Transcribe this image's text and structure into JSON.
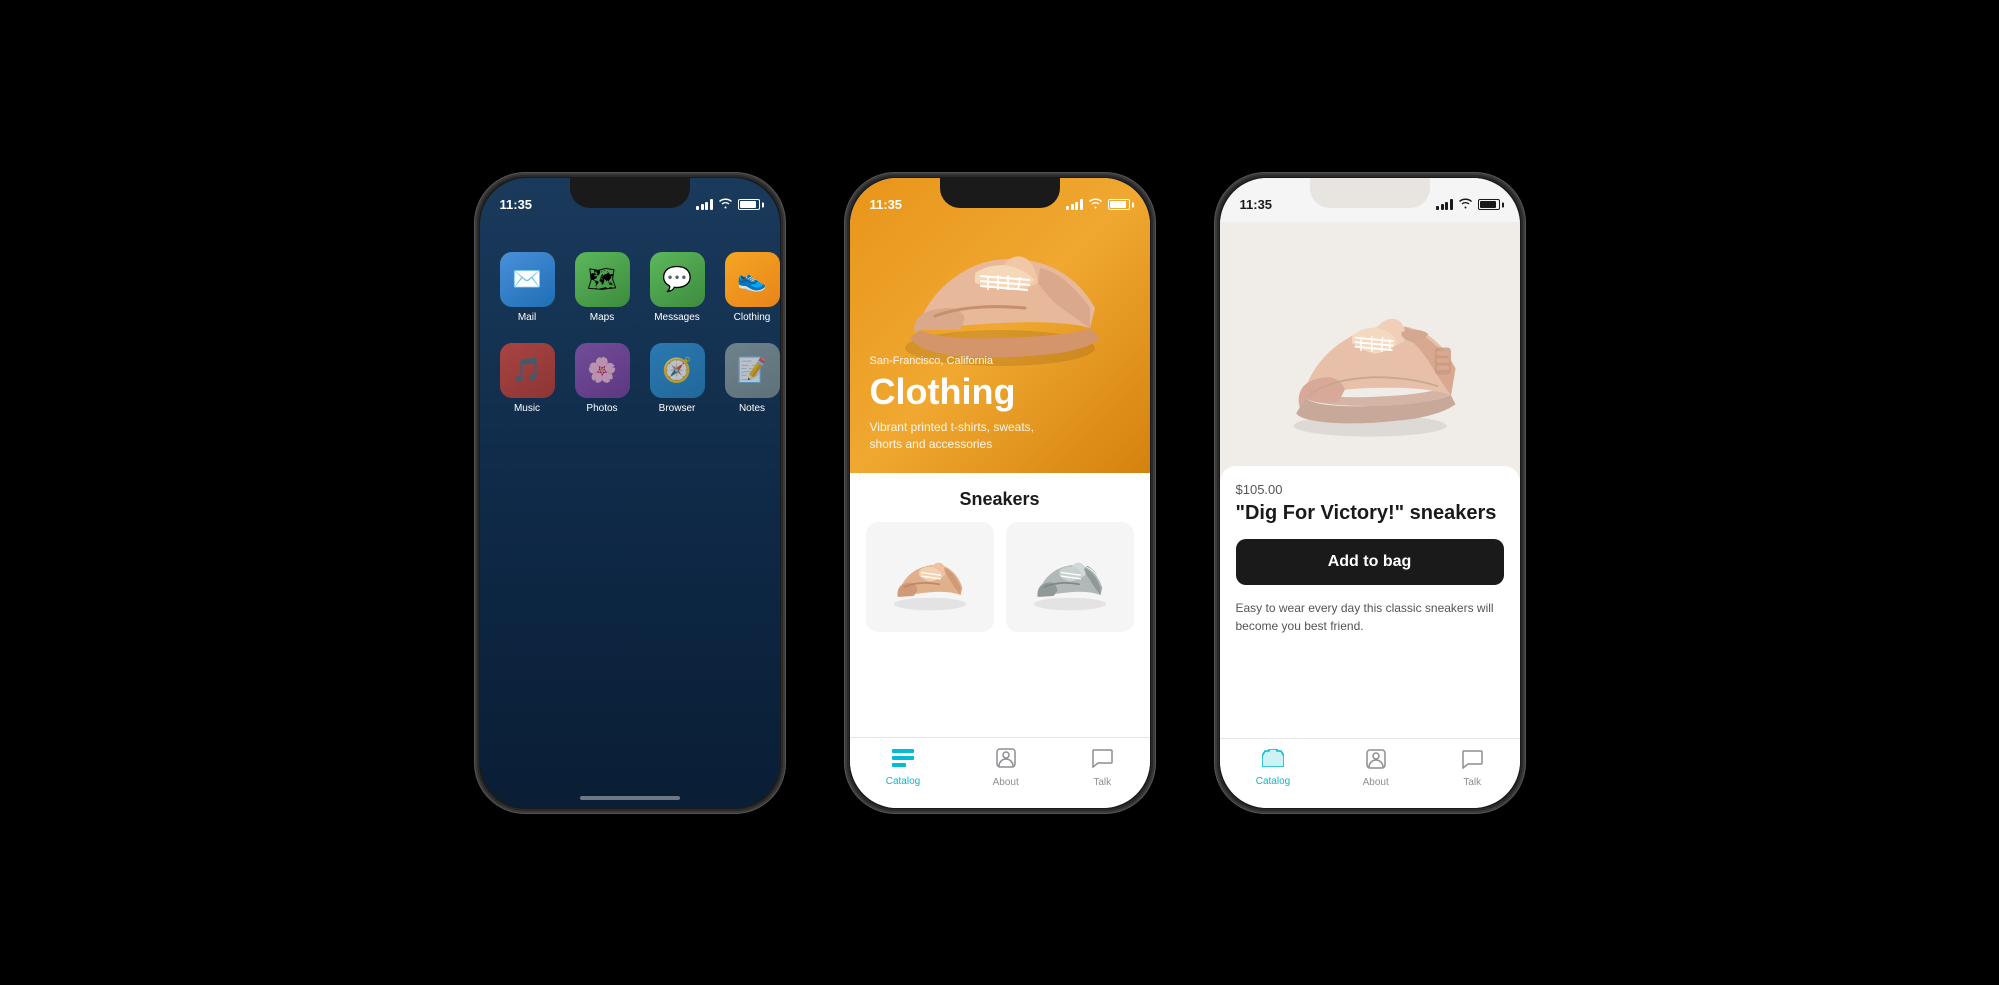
{
  "phones": [
    {
      "id": "home",
      "status": {
        "time": "11:35"
      },
      "apps": [
        {
          "id": "mail",
          "label": "Mail",
          "class": "app-mail",
          "icon": "✉️"
        },
        {
          "id": "maps",
          "label": "Maps",
          "class": "app-maps",
          "icon": "🗺"
        },
        {
          "id": "messages",
          "label": "Messages",
          "class": "app-messages",
          "icon": "💬"
        },
        {
          "id": "clothing",
          "label": "Clothing",
          "class": "app-clothing",
          "icon": "👟"
        },
        {
          "id": "music",
          "label": "Music",
          "class": "app-music",
          "icon": "🎵"
        },
        {
          "id": "photos",
          "label": "Photos",
          "class": "app-photos",
          "icon": "🌸"
        },
        {
          "id": "browser",
          "label": "Browser",
          "class": "app-browser",
          "icon": "🧭"
        },
        {
          "id": "notes",
          "label": "Notes",
          "class": "app-notes",
          "icon": "📝"
        }
      ]
    },
    {
      "id": "catalog",
      "status": {
        "time": "11:35"
      },
      "hero": {
        "location": "San-Francisco, California",
        "title": "Clothing",
        "subtitle": "Vibrant printed t-shirts, sweats, shorts and accessories"
      },
      "section_title": "Sneakers",
      "nav": [
        {
          "id": "catalog",
          "label": "Catalog",
          "active": true
        },
        {
          "id": "about",
          "label": "About",
          "active": false
        },
        {
          "id": "talk",
          "label": "Talk",
          "active": false
        }
      ]
    },
    {
      "id": "detail",
      "status": {
        "time": "11:35"
      },
      "product": {
        "price": "$105.00",
        "title": "\"Dig For Victory!\" sneakers",
        "description": "Easy to wear every day this classic sneakers will become you best friend.",
        "add_to_bag_label": "Add to bag"
      },
      "nav": [
        {
          "id": "catalog",
          "label": "Catalog",
          "active": true
        },
        {
          "id": "about",
          "label": "About",
          "active": false
        },
        {
          "id": "talk",
          "label": "Talk",
          "active": false
        }
      ]
    }
  ]
}
